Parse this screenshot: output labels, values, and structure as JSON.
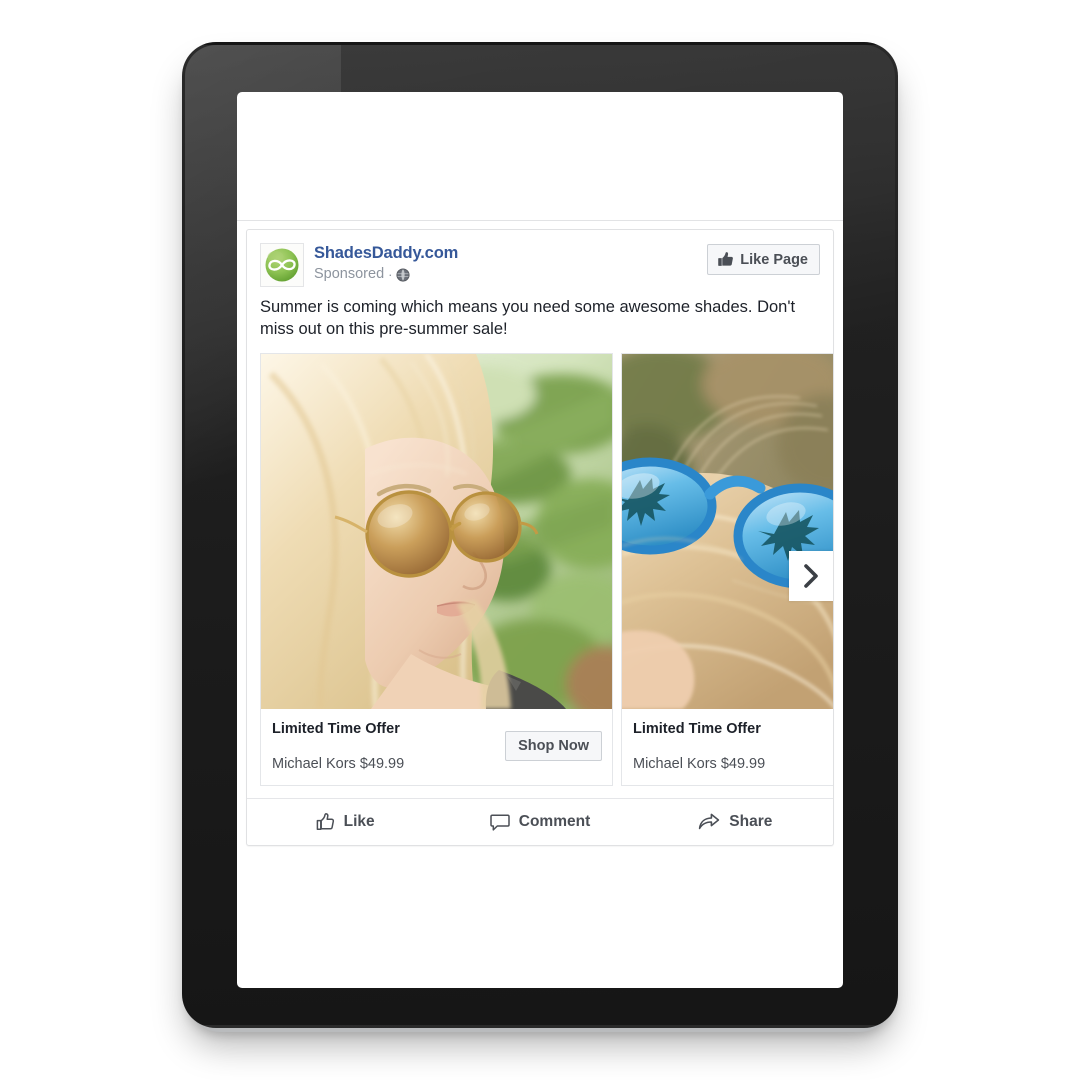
{
  "device": {
    "type": "tablet",
    "orientation": "portrait"
  },
  "post": {
    "page_name": "ShadesDaddy.com",
    "sponsored_label": "Sponsored",
    "meta_separator": "·",
    "audience_icon": "globe-icon",
    "like_page_label": "Like Page",
    "like_page_icon": "thumbs-up-icon",
    "body_text": "Summer is coming which means you need some awesome shades. Don't miss out on this pre-summer sale!",
    "avatar_icon": "shadesdaddy-infinity-logo",
    "colors": {
      "link_blue": "#365899",
      "text_dark": "#1d2129",
      "text_muted": "#8d949e",
      "button_face": "#f6f7f9",
      "button_border": "#ccd0d5",
      "brand_green": "#7cb342"
    }
  },
  "carousel": {
    "next_label": "next",
    "next_icon": "chevron-right-icon",
    "cards": [
      {
        "title": "Limited Time Offer",
        "subtitle": "Michael Kors $49.99",
        "cta_label": "Shop Now",
        "image_alt": "Blonde woman wearing round amber sunglasses with green palm foliage behind her"
      },
      {
        "title": "Limited Time Offer",
        "subtitle": "Michael Kors $49.99",
        "cta_label": "",
        "image_alt": "Close-up of blue mirrored sunglasses resting on blonde hair reflecting palm trees"
      }
    ]
  },
  "actions": [
    {
      "label": "Like",
      "icon": "thumbs-up-outline-icon"
    },
    {
      "label": "Comment",
      "icon": "speech-bubble-icon"
    },
    {
      "label": "Share",
      "icon": "share-arrow-icon"
    }
  ]
}
